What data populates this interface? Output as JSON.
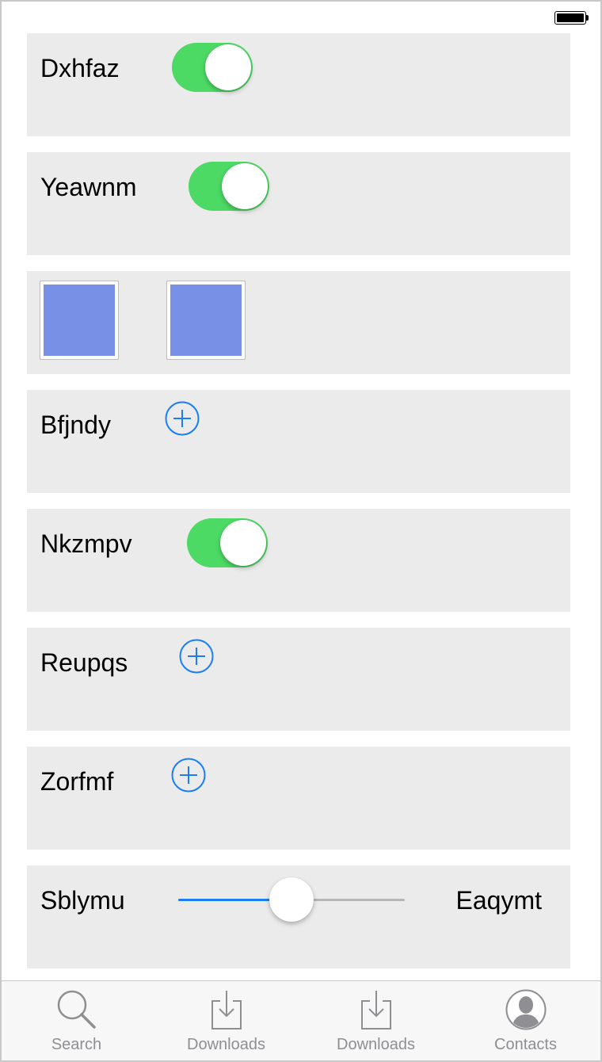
{
  "status_bar": {
    "battery_icon": "battery-full-icon"
  },
  "rows": [
    {
      "label": "Dxhfaz",
      "control": "switch",
      "on": true
    },
    {
      "label": "Yeawnm",
      "control": "switch",
      "on": true
    },
    {
      "label": "",
      "control": "image-pair"
    },
    {
      "label": "Bfjndy",
      "control": "add-button",
      "icon": "plus-circle-icon"
    },
    {
      "label": "Nkzmpv",
      "control": "switch",
      "on": true
    },
    {
      "label": "Reupqs",
      "control": "add-button",
      "icon": "plus-circle-icon"
    },
    {
      "label": "Zorfmf",
      "control": "add-button",
      "icon": "plus-circle-icon"
    },
    {
      "label": "Sblymu",
      "control": "slider",
      "value": 0.5,
      "right_label": "Eaqymt"
    }
  ],
  "tabbar": {
    "tabs": [
      {
        "label": "Search",
        "icon": "search-icon"
      },
      {
        "label": "Downloads",
        "icon": "download-icon"
      },
      {
        "label": "Downloads",
        "icon": "download-icon"
      },
      {
        "label": "Contacts",
        "icon": "contacts-icon"
      }
    ]
  },
  "colors": {
    "switch_on": "#4cd964",
    "accent_blue": "#1a7ef5",
    "row_bg": "#ebebeb",
    "thumbnail_fill": "#7890e5",
    "tab_inactive": "#8e8e93"
  }
}
